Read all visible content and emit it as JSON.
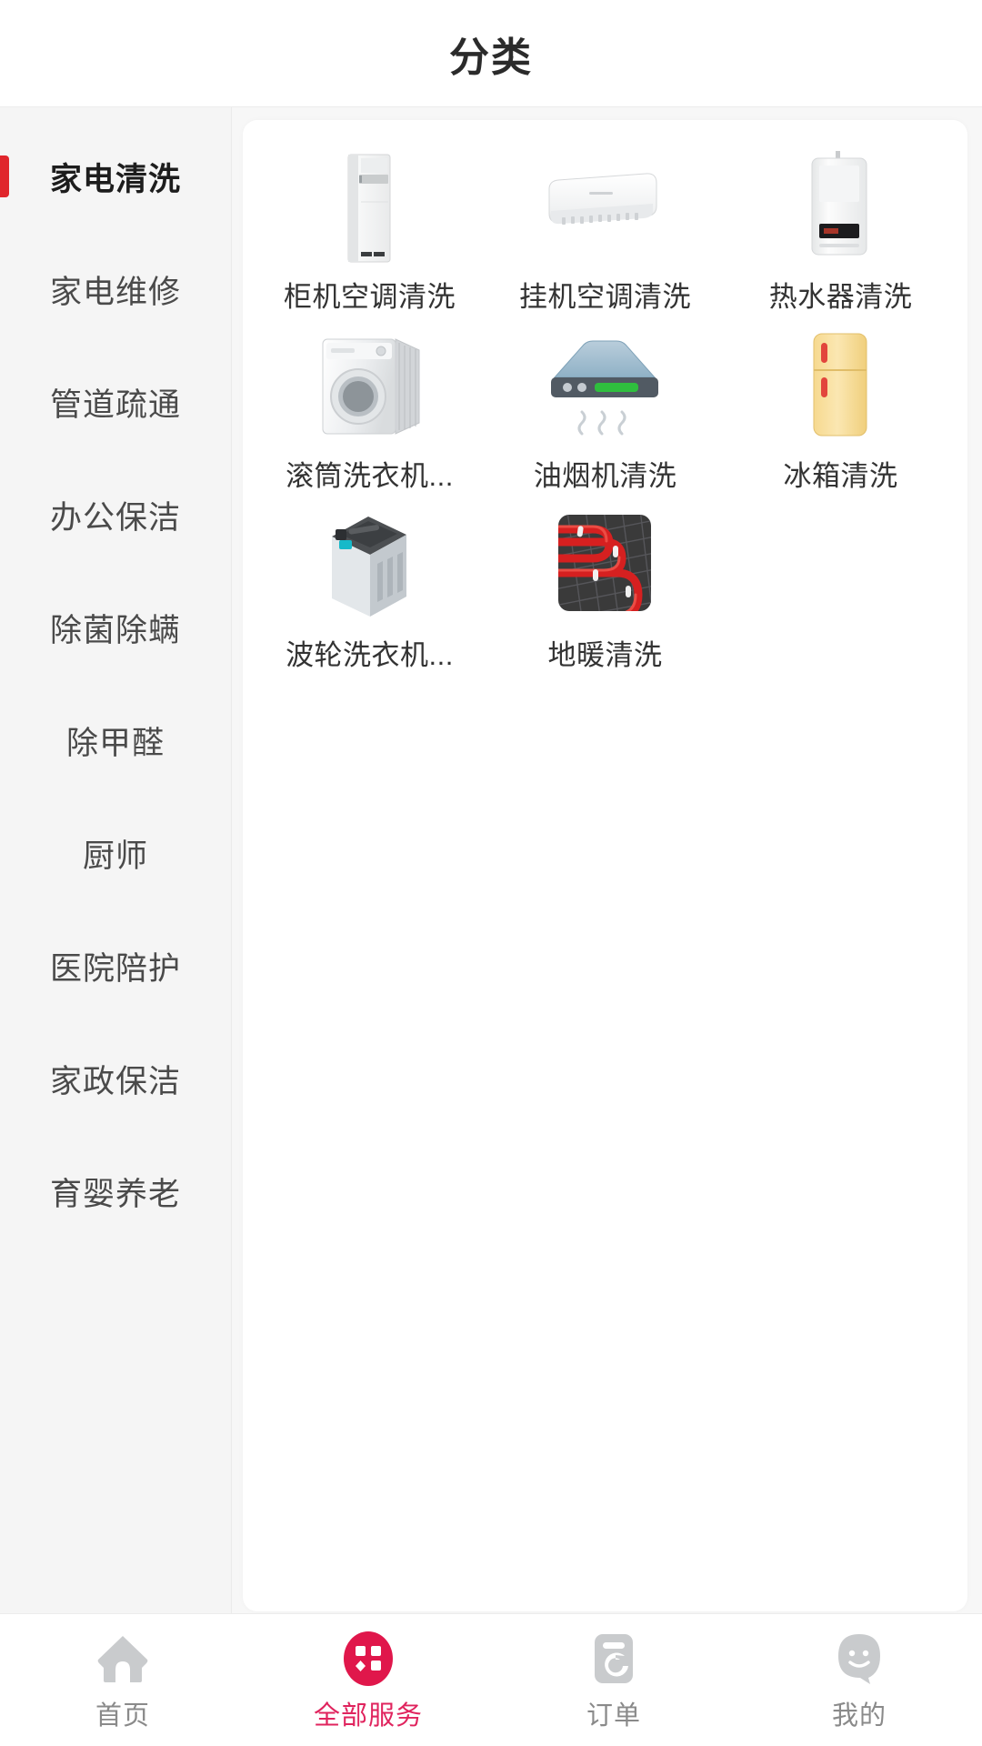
{
  "header": {
    "title": "分类"
  },
  "theme": {
    "accent": "#e0245e",
    "active_bar": "#e0262c",
    "inactive_text": "#8a8a8a",
    "sidebar_bg": "#f5f5f5",
    "panel_bg": "#ffffff"
  },
  "sidebar": {
    "active_index": 0,
    "items": [
      {
        "label": "家电清洗",
        "icon": "category-appliance-cleaning"
      },
      {
        "label": "家电维修",
        "icon": "category-appliance-repair"
      },
      {
        "label": "管道疏通",
        "icon": "category-pipe-dredging"
      },
      {
        "label": "办公保洁",
        "icon": "category-office-cleaning"
      },
      {
        "label": "除菌除螨",
        "icon": "category-sterilize-mite"
      },
      {
        "label": "除甲醛",
        "icon": "category-formaldehyde-removal"
      },
      {
        "label": "厨师",
        "icon": "category-chef"
      },
      {
        "label": "医院陪护",
        "icon": "category-hospital-care"
      },
      {
        "label": "家政保洁",
        "icon": "category-housekeeping"
      },
      {
        "label": "育婴养老",
        "icon": "category-childcare-eldercare"
      }
    ]
  },
  "services": {
    "items": [
      {
        "label": "柜机空调清洗",
        "icon": "cabinet-air-conditioner-icon"
      },
      {
        "label": "挂机空调清洗",
        "icon": "wall-air-conditioner-icon"
      },
      {
        "label": "热水器清洗",
        "icon": "water-heater-icon"
      },
      {
        "label": "滚筒洗衣机...",
        "icon": "drum-washing-machine-icon"
      },
      {
        "label": "油烟机清洗",
        "icon": "range-hood-icon"
      },
      {
        "label": "冰箱清洗",
        "icon": "refrigerator-icon"
      },
      {
        "label": "波轮洗衣机...",
        "icon": "pulsator-washing-machine-icon"
      },
      {
        "label": "地暖清洗",
        "icon": "floor-heating-icon"
      }
    ]
  },
  "tabbar": {
    "active_index": 1,
    "items": [
      {
        "label": "首页",
        "icon": "home-icon"
      },
      {
        "label": "全部服务",
        "icon": "grid-services-icon"
      },
      {
        "label": "订单",
        "icon": "order-icon"
      },
      {
        "label": "我的",
        "icon": "profile-smiley-icon"
      }
    ]
  }
}
